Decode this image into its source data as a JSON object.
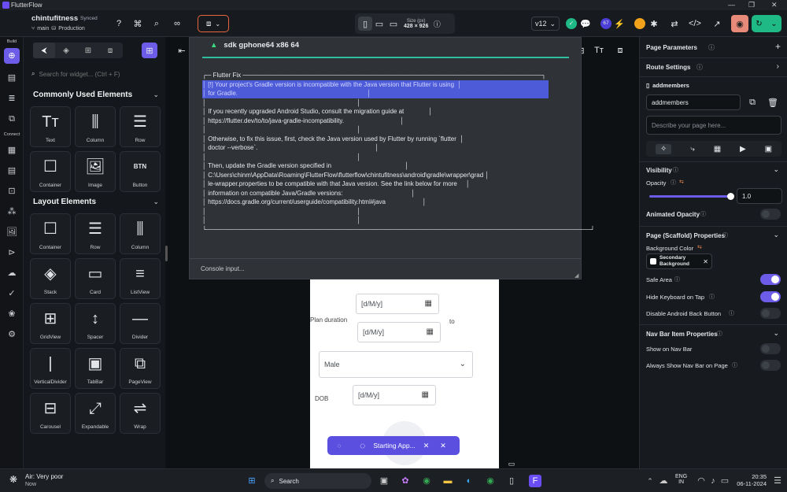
{
  "titlebar": {
    "title": "FlutterFlow",
    "min": "—",
    "max": "❐",
    "close": "✕"
  },
  "header": {
    "project_name": "chintufitness",
    "sync_status": "Synced",
    "branch": "main",
    "environment": "Production",
    "device_size_label": "Size (px)",
    "device_size": "428 × 926",
    "version": "v12",
    "badge_count": "67"
  },
  "rail": {
    "build_label": "Build",
    "connect_label": "Connect"
  },
  "widgets": {
    "search_placeholder": "Search for widget... (Ctrl + F)",
    "common_title": "Commonly Used Elements",
    "common": [
      {
        "label": "Text",
        "icon": "Tт"
      },
      {
        "label": "Column",
        "icon": "⫼"
      },
      {
        "label": "Row",
        "icon": "☰"
      },
      {
        "label": "Container",
        "icon": "☐"
      },
      {
        "label": "Image",
        "icon": "🖼"
      },
      {
        "label": "Button",
        "icon": "BTN"
      }
    ],
    "layout_title": "Layout Elements",
    "layout": [
      {
        "label": "Container",
        "icon": "☐"
      },
      {
        "label": "Row",
        "icon": "☰"
      },
      {
        "label": "Column",
        "icon": "⫼"
      },
      {
        "label": "Stack",
        "icon": "◈"
      },
      {
        "label": "Card",
        "icon": "▭"
      },
      {
        "label": "ListView",
        "icon": "≡"
      },
      {
        "label": "GridView",
        "icon": "⊞"
      },
      {
        "label": "Spacer",
        "icon": "↕"
      },
      {
        "label": "Divider",
        "icon": "—"
      },
      {
        "label": "VerticalDivider",
        "icon": "|"
      },
      {
        "label": "TabBar",
        "icon": "▣"
      },
      {
        "label": "PageView",
        "icon": "⧉"
      },
      {
        "label": "Carousel",
        "icon": "⊟"
      },
      {
        "label": "Expandable",
        "icon": "⤢"
      },
      {
        "label": "Wrap",
        "icon": "⇌"
      }
    ]
  },
  "console": {
    "device": "sdk gphone64 x86 64",
    "lines": [
      "┌─ Flutter Fix ───────────────────────────────────────────────────────────────────┐",
      "│ [!] Your project's Gradle version is incompatible with the Java version that Flutter is using  │",
      "│ for Gradle.                                                                          │",
      "│                                                                                      │",
      "│ If you recently upgraded Android Studio, consult the migration guide at              │",
      "│ https://flutter.dev/to/to/java-gradle-incompatibility.                                │",
      "│                                                                                      │",
      "│ Otherwise, to fix this issue, first, check the Java version used by Flutter by running `flutter  │",
      "│ doctor --verbose`.                                                                   │",
      "│                                                                                      │",
      "│ Then, update the Gradle version specified in                                          │",
      "│ C:\\Users\\chinm\\AppData\\Roaming\\FlutterFlow\\flutterflow\\chintufitness\\android\\gradle\\wrapper\\grad │",
      "│ le-wrapper.properties to be compatible with that Java version. See the link below for more     │",
      "│ information on compatible Java/Gradle versions:                                       │",
      "│ https://docs.gradle.org/current/userguide/compatibility.html#java                     │",
      "│                                                                                      │",
      "│                                                                                      │",
      "└──────────────────────────────────────────────────────────────────────────────────────┘"
    ],
    "input_placeholder": "Console input..."
  },
  "phone": {
    "plan_duration_label": "Plan duration",
    "to_label": "to",
    "date_placeholder": "[d/M/y]",
    "gender_value": "Male",
    "dob_label": "DOB"
  },
  "toast": {
    "text": "Starting App..."
  },
  "props": {
    "page_parameters": "Page Parameters",
    "route_settings": "Route Settings",
    "page_name_label": "addmembers",
    "page_name_value": "addmembers",
    "description_placeholder": "Describe your page here...",
    "visibility": "Visibility",
    "opacity": "Opacity",
    "opacity_value": "1.0",
    "opacity_fraction": 1.0,
    "animated_opacity": "Animated Opacity",
    "scaffold_props": "Page (Scaffold) Properties",
    "background_color": "Background Color",
    "background_value_line1": "Secondary",
    "background_value_line2": "Background",
    "safe_area": "Safe Area",
    "hide_keyboard": "Hide Keyboard on Tap",
    "disable_back": "Disable Android Back Button",
    "nav_bar_props": "Nav Bar Item Properties",
    "show_nav": "Show on Nav Bar",
    "always_show_nav": "Always Show Nav Bar on Page"
  },
  "taskbar": {
    "weather_title": "Air: Very poor",
    "weather_sub": "Now",
    "search_placeholder": "Search",
    "lang1": "ENG",
    "lang2": "IN",
    "time": "20:35",
    "date": "06-11-2024"
  },
  "colors": {
    "accent": "#6c5ce7",
    "highlight": "#4d5bd8",
    "brand": "#6b4df5"
  }
}
